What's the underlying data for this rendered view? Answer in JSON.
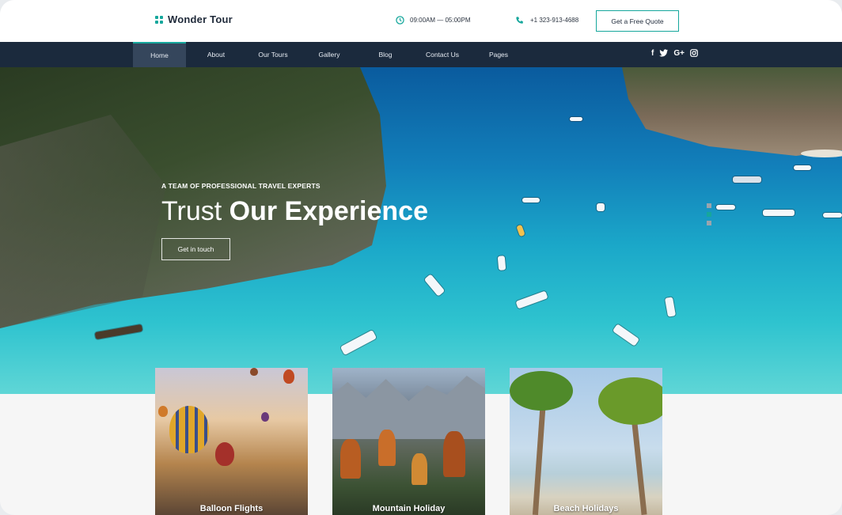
{
  "brand": {
    "name": "Wonder Tour",
    "accent": "#16a79c",
    "nav_bg": "#1b2a3d"
  },
  "header": {
    "hours": "09:00AM — 05:00PM",
    "phone": "+1 323-913-4688",
    "quote_button": "Get a Free Quote"
  },
  "nav": {
    "items": [
      {
        "label": "Home",
        "active": true
      },
      {
        "label": "About"
      },
      {
        "label": "Our Tours"
      },
      {
        "label": "Gallery"
      },
      {
        "label": "Blog"
      },
      {
        "label": "Contact Us"
      },
      {
        "label": "Pages"
      }
    ],
    "social": [
      "facebook-icon",
      "twitter-icon",
      "google-plus-icon",
      "instagram-icon"
    ]
  },
  "hero": {
    "eyebrow": "A TEAM OF PROFESSIONAL TRAVEL EXPERTS",
    "headline_light": "Trust",
    "headline_bold": "Our Experience",
    "cta": "Get in touch",
    "slides_count": 3,
    "active_slide": 2
  },
  "cards": [
    {
      "label": "Balloon Flights"
    },
    {
      "label": "Mountain Holiday"
    },
    {
      "label": "Beach Holidays"
    }
  ]
}
